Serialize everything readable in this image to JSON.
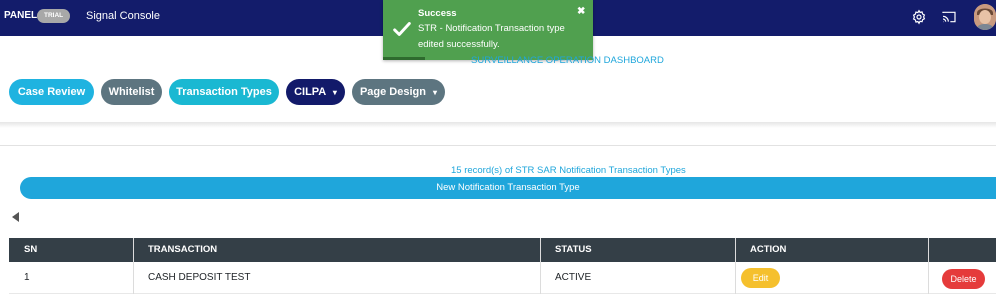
{
  "header": {
    "brand": "PANEL",
    "badge": "TRIAL",
    "title": "Signal Console",
    "icons": [
      "gear-icon",
      "cast-icon",
      "user-avatar"
    ]
  },
  "toast": {
    "title": "Success",
    "message": "STR - Notification Transaction type edited successfully.",
    "close": "✖",
    "icon": "check-icon"
  },
  "dashboard": {
    "title": "SURVEILLANCE OPERATION DASHBOARD"
  },
  "nav": {
    "case_review": "Case Review",
    "whitelist": "Whitelist",
    "transaction_types": "Transaction Types",
    "cilpa": "CILPA",
    "page_design": "Page Design",
    "caret": "▾"
  },
  "records": {
    "count_text": "15 record(s) of STR SAR Notification Transaction Types",
    "new_button": "New Notification Transaction Type"
  },
  "table": {
    "columns": [
      "SN",
      "TRANSACTION",
      "STATUS",
      "ACTION"
    ],
    "rows": [
      {
        "sn": "1",
        "transaction": "CASH DEPOSIT TEST",
        "status": "ACTIVE",
        "edit": "Edit",
        "delete": "Delete"
      }
    ]
  },
  "colors": {
    "topbar": "#131c6b",
    "toast": "#50a04f",
    "accent": "#1fa6db",
    "edit": "#f5c02d",
    "delete": "#e53b3b"
  }
}
